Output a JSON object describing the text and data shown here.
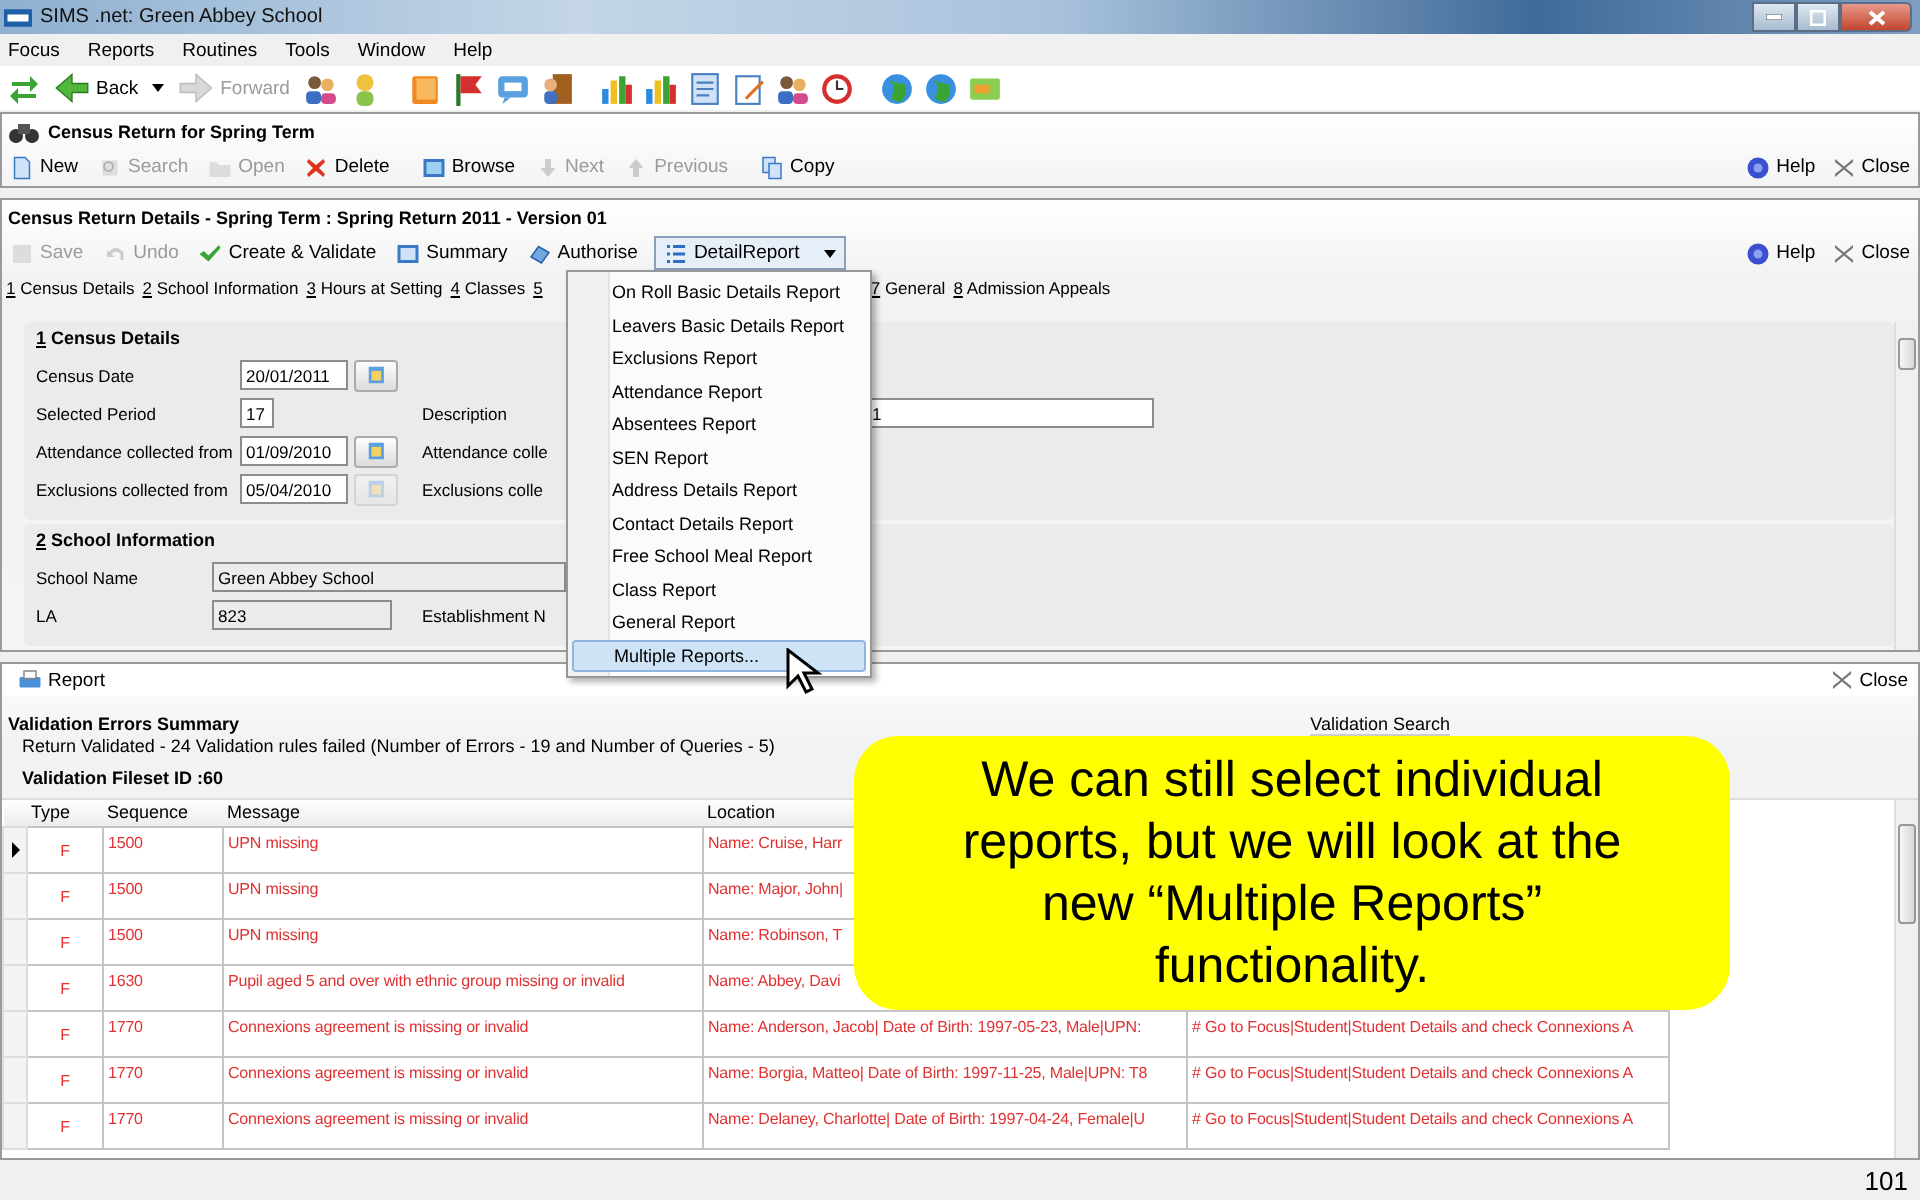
{
  "window": {
    "title": "SIMS .net: Green Abbey School"
  },
  "menu": [
    {
      "label": "Focus"
    },
    {
      "label": "Reports"
    },
    {
      "label": "Routines"
    },
    {
      "label": "Tools"
    },
    {
      "label": "Window"
    },
    {
      "label": "Help"
    }
  ],
  "toolbar": {
    "back": {
      "label": "Back",
      "disabled": false
    },
    "forward": {
      "label": "Forward",
      "disabled": true
    }
  },
  "census_panel": {
    "title": "Census Return for Spring Term",
    "help": "Help",
    "close": "Close",
    "buttons": [
      {
        "label": "New",
        "disabled": false
      },
      {
        "label": "Search",
        "disabled": true
      },
      {
        "label": "Open",
        "disabled": true
      },
      {
        "label": "Delete",
        "disabled": false
      },
      {
        "label": "Browse",
        "disabled": false
      },
      {
        "label": "Next",
        "disabled": true
      },
      {
        "label": "Previous",
        "disabled": true
      },
      {
        "label": "Copy",
        "disabled": false
      }
    ]
  },
  "details_panel": {
    "title": "Census Return Details - Spring Term : Spring Return 2011 - Version 01",
    "help": "Help",
    "close": "Close",
    "buttons": [
      {
        "label": "Save",
        "disabled": true
      },
      {
        "label": "Undo",
        "disabled": true
      },
      {
        "label": "Create & Validate",
        "disabled": false
      },
      {
        "label": "Summary",
        "disabled": false
      },
      {
        "label": "Authorise",
        "disabled": false
      }
    ],
    "dropdown": {
      "label": "DetailReport",
      "expanded": true
    },
    "section_links": [
      {
        "key": "1",
        "label": "Census Details"
      },
      {
        "key": "2",
        "label": "School Information"
      },
      {
        "key": "3",
        "label": "Hours at Setting"
      },
      {
        "key": "4",
        "label": "Classes"
      },
      {
        "key": "5"
      }
    ],
    "section_links_after_menu": [
      {
        "key": "7",
        "label": "General"
      },
      {
        "key": "8",
        "label": "Admission Appeals"
      }
    ],
    "sections": [
      {
        "key": "1",
        "title": "Census Details",
        "rows": [
          {
            "label": "Census Date",
            "value": "20/01/2011",
            "kind": "date",
            "calendar_disabled": false
          },
          {
            "label": "Selected Period",
            "value": "17",
            "kind": "number",
            "right": {
              "label": "Description",
              "value": "1"
            }
          },
          {
            "label": "Attendance collected from",
            "value": "01/09/2010",
            "kind": "date",
            "calendar_disabled": false,
            "right": {
              "label": "Attendance colle"
            }
          },
          {
            "label": "Exclusions collected from",
            "value": "05/04/2010",
            "kind": "date",
            "calendar_disabled": true,
            "right": {
              "label": "Exclusions colle"
            }
          }
        ]
      },
      {
        "key": "2",
        "title": "School Information",
        "rows": [
          {
            "label": "School Name",
            "value": "Green Abbey School",
            "kind": "text"
          },
          {
            "label": "LA",
            "value": "823",
            "kind": "short",
            "right": {
              "label": "Establishment N"
            }
          }
        ]
      }
    ]
  },
  "report_menu": {
    "items": [
      {
        "label": "On Roll Basic Details Report",
        "selected": false
      },
      {
        "label": "Leavers Basic Details Report",
        "selected": false
      },
      {
        "label": "Exclusions Report",
        "selected": false
      },
      {
        "label": "Attendance Report",
        "selected": false
      },
      {
        "label": "Absentees Report",
        "selected": false
      },
      {
        "label": "SEN Report",
        "selected": false
      },
      {
        "label": "Address Details Report",
        "selected": false
      },
      {
        "label": "Contact Details Report",
        "selected": false
      },
      {
        "label": "Free School Meal Report",
        "selected": false
      },
      {
        "label": "Class Report",
        "selected": false
      },
      {
        "label": "General Report",
        "selected": false
      },
      {
        "label": "Multiple Reports...",
        "selected": true
      }
    ]
  },
  "report_panel": {
    "report_button": "Report",
    "close": "Close",
    "summary_title": "Validation Errors Summary",
    "summary_text": "Return Validated - 24 Validation rules failed (Number of Errors - 19 and Number of Queries - 5)",
    "search_label": "Validation Search",
    "fileset": "Validation Fileset ID :60",
    "columns": [
      "Type",
      "Sequence",
      "Message",
      "Location"
    ],
    "rows": [
      {
        "type": "F",
        "sequence": "1500",
        "message": "UPN missing",
        "location": "Name: Cruise, Harr",
        "selected": true
      },
      {
        "type": "F",
        "sequence": "1500",
        "message": "UPN missing",
        "location": "Name: Major, John|",
        "selected": false
      },
      {
        "type": "F",
        "sequence": "1500",
        "message": "UPN missing",
        "location": "Name: Robinson, T",
        "selected": false
      },
      {
        "type": "F",
        "sequence": "1630",
        "message": "Pupil aged 5 and over with ethnic group missing or invalid",
        "location": "Name: Abbey, Davi",
        "selected": false
      },
      {
        "type": "F",
        "sequence": "1770",
        "message": "Connexions agreement is missing or invalid",
        "location": "Name: Anderson, Jacob| Date of Birth: 1997-05-23, Male|UPN:",
        "column_5": "# Go to Focus|Student|Student Details and check Connexions A",
        "selected": false
      },
      {
        "type": "F",
        "sequence": "1770",
        "message": "Connexions agreement is missing or invalid",
        "location": "Name: Borgia, Matteo| Date of Birth: 1997-11-25, Male|UPN: T8",
        "column_5": "# Go to Focus|Student|Student Details and check Connexions A",
        "selected": false
      },
      {
        "type": "F",
        "sequence": "1770",
        "message": "Connexions agreement is missing or invalid",
        "location": "Name: Delaney, Charlotte| Date of Birth: 1997-04-24, Female|U",
        "column_5": "# Go to Focus|Student|Student Details and check Connexions A",
        "selected": false
      }
    ]
  },
  "callout": "We can still select individual reports, but we will look at the new “Multiple Reports” functionality.",
  "slide_number": "101"
}
